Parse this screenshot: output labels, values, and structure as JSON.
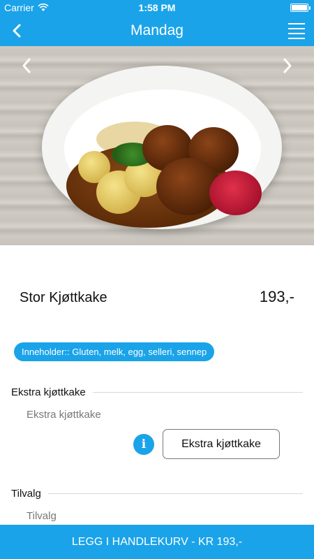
{
  "status_bar": {
    "carrier": "Carrier",
    "time": "1:58 PM",
    "battery_level": 1.0
  },
  "nav": {
    "title": "Mandag",
    "back_icon": "chevron-left-icon",
    "menu_icon": "hamburger-menu-icon"
  },
  "hero": {
    "prev_icon": "chevron-left-icon",
    "next_icon": "chevron-right-icon"
  },
  "product": {
    "name": "Stor Kjøttkake",
    "price": "193,-"
  },
  "allergens": "Inneholder:: Gluten, melk, egg, selleri, sennep",
  "options": {
    "extra_header": "Ekstra kjøttkake",
    "extra_label": "Ekstra kjøttkake",
    "extra_button": "Ekstra kjøttkake",
    "tilvalg_header": "Tilvalg",
    "tilvalg_label": "Tilvalg"
  },
  "cart_button": "LEGG I HANDLEKURV - KR 193,-",
  "colors": {
    "accent": "#1aa3e8"
  }
}
